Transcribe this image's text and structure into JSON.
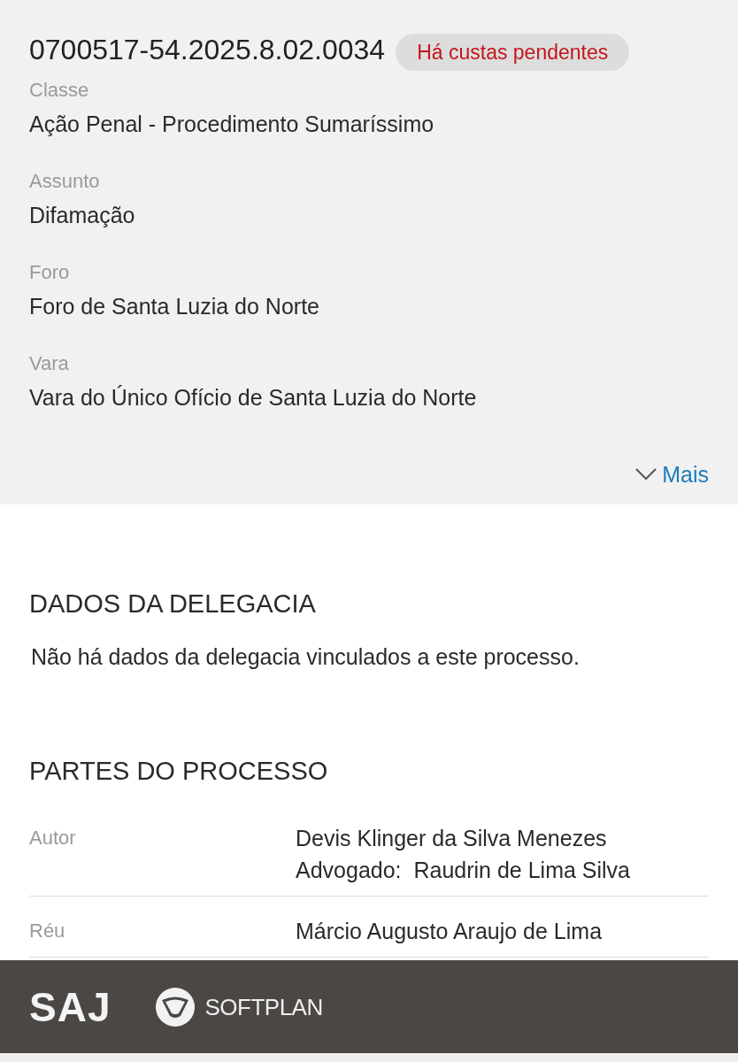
{
  "process": {
    "number": "0700517-54.2025.8.02.0034",
    "badge": "Há custas pendentes"
  },
  "fields": [
    {
      "label": "Classe",
      "value": "Ação Penal - Procedimento Sumaríssimo"
    },
    {
      "label": "Assunto",
      "value": "Difamação"
    },
    {
      "label": "Foro",
      "value": "Foro de Santa Luzia do Norte"
    },
    {
      "label": "Vara",
      "value": "Vara do Único Ofício de Santa Luzia do Norte"
    }
  ],
  "more_link": {
    "label": "Mais",
    "expanded": false
  },
  "delegacia": {
    "title": "DADOS DA DELEGACIA",
    "text": "Não há dados da delegacia vinculados a este processo."
  },
  "partes": {
    "title": "PARTES DO PROCESSO",
    "rows": [
      {
        "role": "Autor",
        "lines": [
          "Devis Klinger da Silva Menezes",
          "Advogado:  Raudrin de Lima Silva"
        ]
      },
      {
        "role": "Réu",
        "lines": [
          "Márcio Augusto Araujo de Lima"
        ]
      }
    ]
  },
  "footer": {
    "logos": [
      {
        "kind": "wordmark",
        "text": "SAJ"
      },
      {
        "kind": "emblem",
        "text": "SOFTPLAN"
      }
    ]
  }
}
